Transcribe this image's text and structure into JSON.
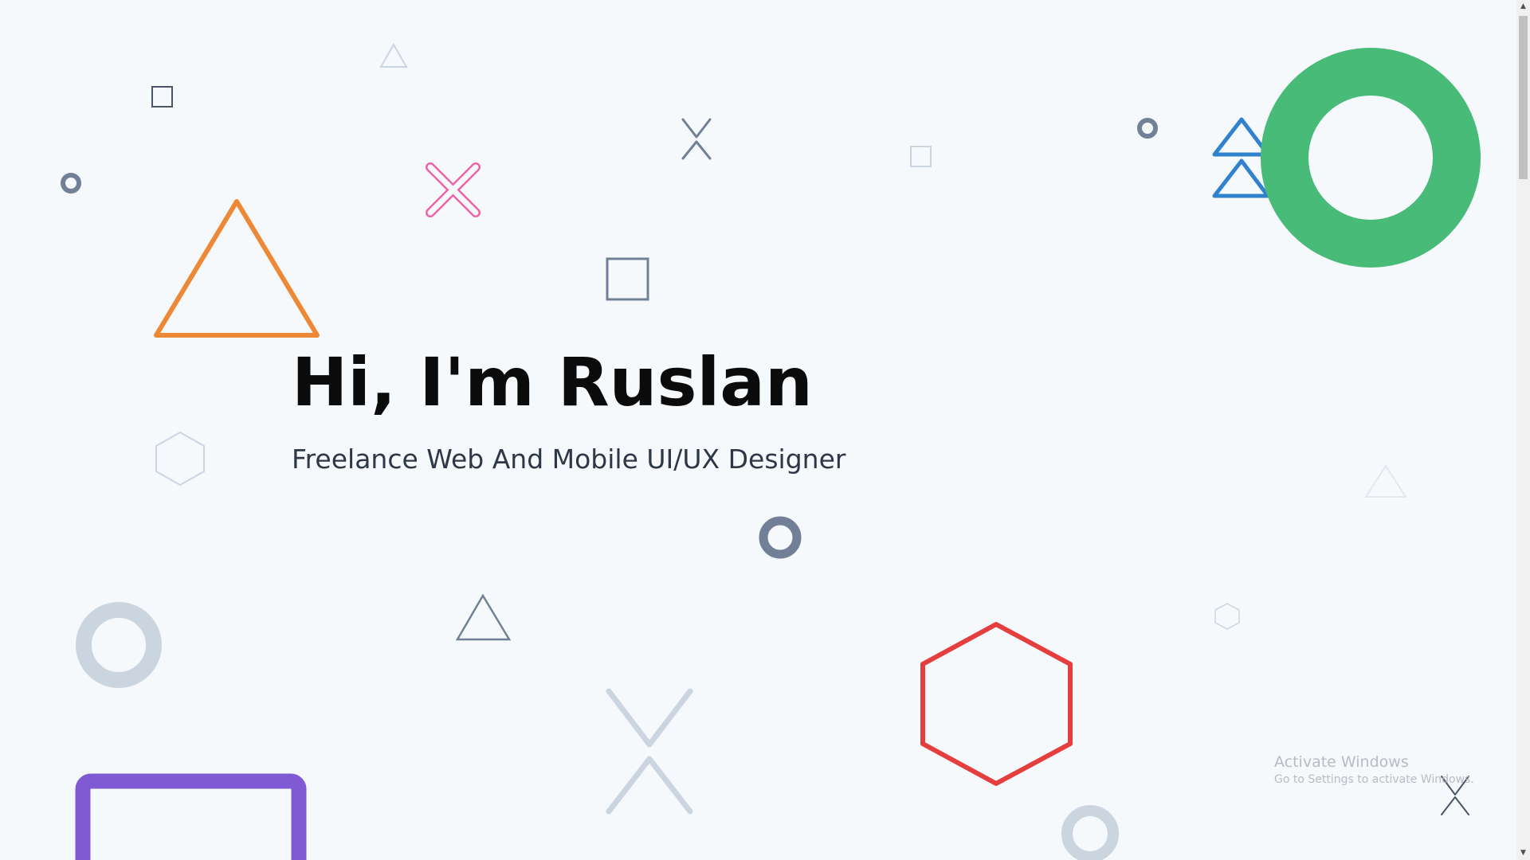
{
  "hero": {
    "title": "Hi, I'm Ruslan",
    "subtitle": "Freelance Web And Mobile UI/UX Designer"
  },
  "watermark": {
    "title": "Activate Windows",
    "subtitle": "Go to Settings to activate Windows."
  },
  "scrollbar": {
    "up_arrow": "▲",
    "down_arrow": "▼"
  },
  "colors": {
    "background": "#f6f9fc",
    "orange": "#ed8936",
    "pink": "#ed64a6",
    "blue": "#3182ce",
    "green": "#48bb78",
    "red": "#e53e3e",
    "purple": "#805ad5",
    "slate": "#718096",
    "light_slate": "#cbd5e0"
  },
  "decorations": {
    "shapes": [
      "triangle",
      "x-mark",
      "square",
      "circle-ring",
      "hexagon",
      "double-chevron"
    ]
  }
}
